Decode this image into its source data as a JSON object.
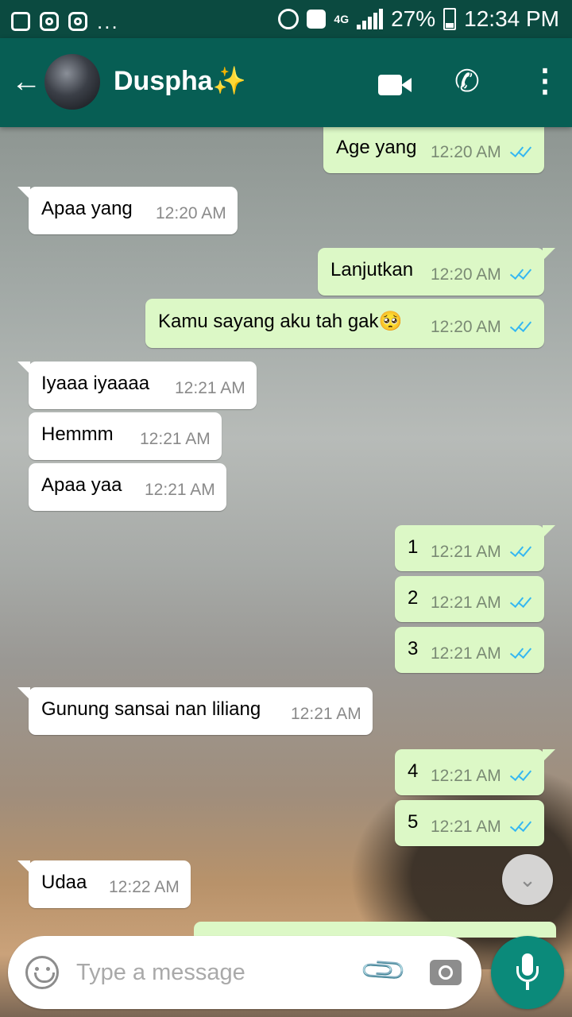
{
  "status_bar": {
    "dots": "...",
    "network": "4G",
    "battery": "27%",
    "time": "12:34 PM"
  },
  "header": {
    "title": "Duspha✨",
    "back_icon": "arrow-left-icon",
    "video_icon": "video-call-icon",
    "call_icon": "phone-icon",
    "menu_icon": "more-vertical-icon"
  },
  "messages": [
    {
      "dir": "out",
      "text": "Age yang",
      "time": "12:20 AM"
    },
    {
      "dir": "in",
      "text": "Apaa yang",
      "time": "12:20 AM"
    },
    {
      "dir": "out",
      "text": "Lanjutkan",
      "time": "12:20 AM"
    },
    {
      "dir": "out",
      "text": "Kamu sayang aku tah gak🥺",
      "time": "12:20 AM"
    },
    {
      "dir": "in",
      "text": "Iyaaa iyaaaa",
      "time": "12:21 AM"
    },
    {
      "dir": "in",
      "text": "Hemmm",
      "time": "12:21 AM"
    },
    {
      "dir": "in",
      "text": "Apaa yaa",
      "time": "12:21 AM"
    },
    {
      "dir": "out",
      "text": "1",
      "time": "12:21 AM"
    },
    {
      "dir": "out",
      "text": "2",
      "time": "12:21 AM"
    },
    {
      "dir": "out",
      "text": "3",
      "time": "12:21 AM"
    },
    {
      "dir": "in",
      "text": "Gunung sansai nan liliang",
      "time": "12:21 AM"
    },
    {
      "dir": "out",
      "text": "4",
      "time": "12:21 AM"
    },
    {
      "dir": "out",
      "text": "5",
      "time": "12:21 AM"
    },
    {
      "dir": "in",
      "text": "Udaa",
      "time": "12:22 AM"
    }
  ],
  "input": {
    "placeholder": "Type a message",
    "emoji_icon": "emoji-icon",
    "attach_icon": "paperclip-icon",
    "camera_icon": "camera-icon",
    "mic_icon": "microphone-icon"
  },
  "colors": {
    "header": "#075e54",
    "status_bar": "#0b4a40",
    "outgoing_bubble": "#dcf8c6",
    "incoming_bubble": "#ffffff",
    "read_tick": "#34b7f1",
    "mic_button": "#0b8a7a"
  }
}
